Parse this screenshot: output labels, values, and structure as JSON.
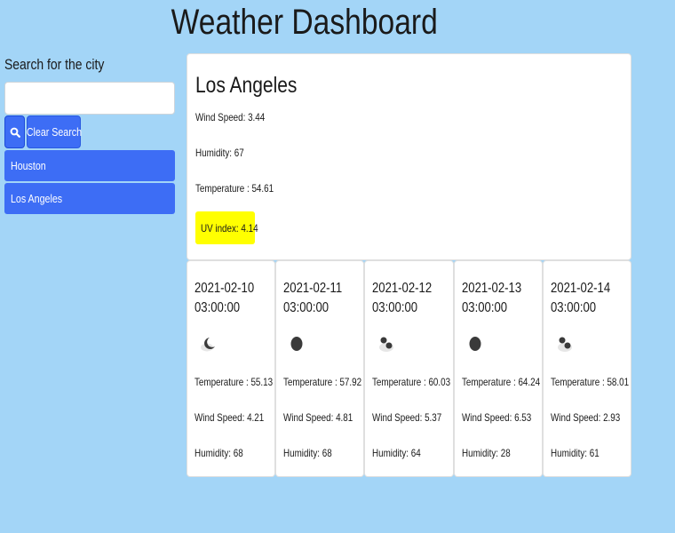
{
  "page": {
    "title": "Weather Dashboard"
  },
  "sidebar": {
    "search_label": "Search for the city",
    "search_value": "",
    "search_placeholder": "",
    "search_button_icon": "search-icon",
    "clear_button_label": "Clear Search",
    "cities": [
      {
        "label": "Houston"
      },
      {
        "label": "Los Angeles"
      }
    ]
  },
  "current": {
    "city": "Los Angeles",
    "wind": "Wind Speed: 3.44",
    "humidity": "Humidity: 67",
    "temperature": "Temperature : 54.61",
    "uv": "UV index: 4.14",
    "uv_color": "#ffff00"
  },
  "forecast": [
    {
      "date": "2021-02-10",
      "time": "03:00:00",
      "icon": "partly-cloudy-night-icon",
      "temperature": "Temperature : 55.13",
      "wind": "Wind Speed: 4.21",
      "humidity": "Humidity: 68"
    },
    {
      "date": "2021-02-11",
      "time": "03:00:00",
      "icon": "clear-night-icon",
      "temperature": "Temperature : 57.92",
      "wind": "Wind Speed: 4.81",
      "humidity": "Humidity: 68"
    },
    {
      "date": "2021-02-12",
      "time": "03:00:00",
      "icon": "cloudy-night-icon",
      "temperature": "Temperature : 60.03",
      "wind": "Wind Speed: 5.37",
      "humidity": "Humidity: 64"
    },
    {
      "date": "2021-02-13",
      "time": "03:00:00",
      "icon": "clear-night-icon",
      "temperature": "Temperature : 64.24",
      "wind": "Wind Speed: 6.53",
      "humidity": "Humidity: 28"
    },
    {
      "date": "2021-02-14",
      "time": "03:00:00",
      "icon": "cloudy-night-icon",
      "temperature": "Temperature : 58.01",
      "wind": "Wind Speed: 2.93",
      "humidity": "Humidity: 61"
    }
  ],
  "colors": {
    "background": "#a3d5f7",
    "button": "#3d6df5",
    "uv_highlight": "#ffff00"
  }
}
